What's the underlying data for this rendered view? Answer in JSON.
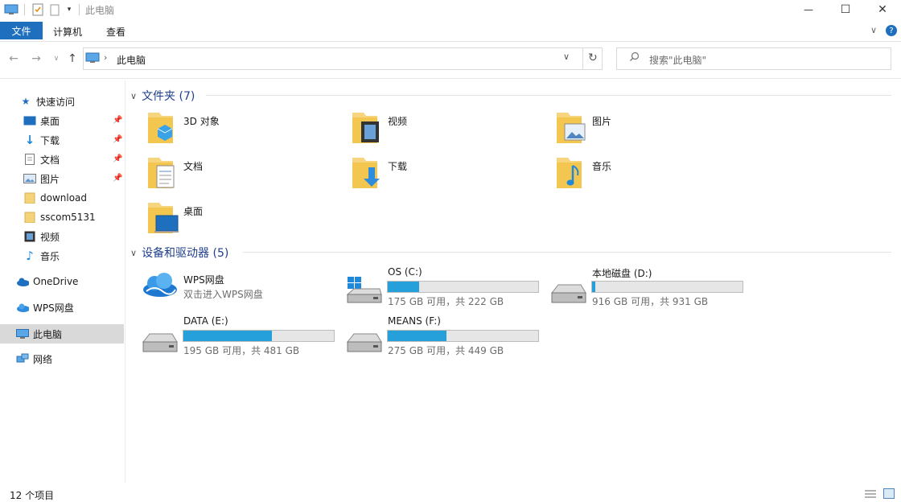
{
  "window": {
    "title": "此电脑",
    "controls": {
      "minimize": "—",
      "maximize": "☐",
      "close": "✕"
    }
  },
  "ribbon": {
    "tabs": [
      "文件",
      "计算机",
      "查看"
    ],
    "help_icon": "?",
    "expand_icon": "chevron-down"
  },
  "address": {
    "path": "此电脑",
    "search_placeholder": "搜索\"此电脑\""
  },
  "nav": {
    "quick_access": "快速访问",
    "items": [
      "桌面",
      "下载",
      "文档",
      "图片",
      "download",
      "sscom5131",
      "视频",
      "音乐"
    ],
    "onedrive": "OneDrive",
    "wps": "WPS网盘",
    "this_pc": "此电脑",
    "network": "网络"
  },
  "folders": {
    "header": "文件夹 (7)",
    "items": [
      "3D 对象",
      "视频",
      "图片",
      "文档",
      "下载",
      "音乐",
      "桌面"
    ]
  },
  "devices": {
    "header": "设备和驱动器 (5)",
    "wps": {
      "name": "WPS网盘",
      "sub": "双击进入WPS网盘"
    },
    "drives": [
      {
        "name": "OS (C:)",
        "free": "175 GB 可用，共 222 GB",
        "used_fraction": 0.21
      },
      {
        "name": "本地磁盘 (D:)",
        "free": "916 GB 可用，共 931 GB",
        "used_fraction": 0.02
      },
      {
        "name": "DATA (E:)",
        "free": "195 GB 可用，共 481 GB",
        "used_fraction": 0.59
      },
      {
        "name": "MEANS (F:)",
        "free": "275 GB 可用，共 449 GB",
        "used_fraction": 0.39
      }
    ]
  },
  "status": {
    "count": "12 个项目"
  },
  "colors": {
    "accent": "#1f6fbf",
    "bar_fill": "#26a0da",
    "header_text": "#1e3f8c"
  }
}
